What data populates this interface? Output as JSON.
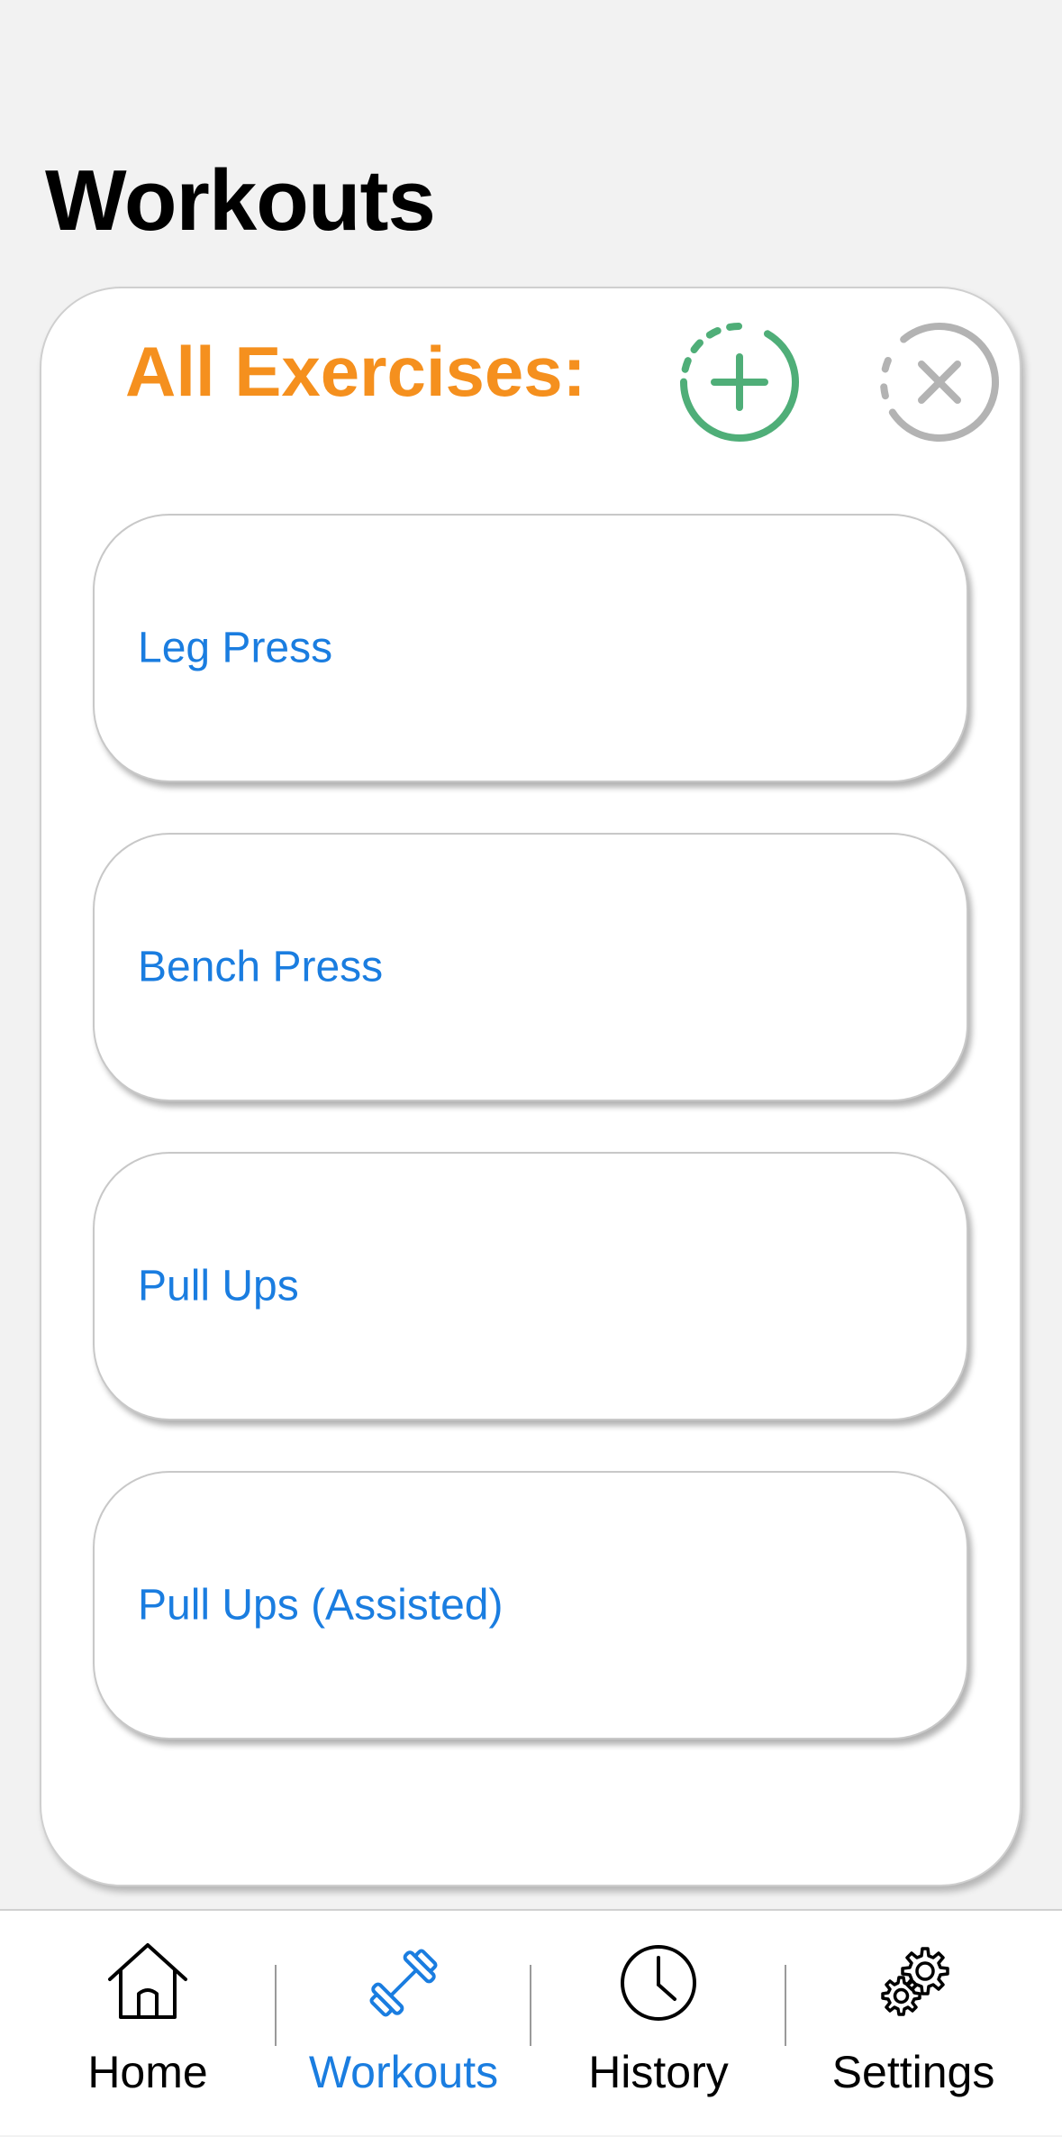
{
  "header": {
    "title": "Workouts"
  },
  "panel": {
    "title": "All Exercises:",
    "add_icon": "add-circle-icon",
    "close_icon": "close-circle-icon"
  },
  "exercises": [
    {
      "label": "Leg Press"
    },
    {
      "label": "Bench Press"
    },
    {
      "label": "Pull Ups"
    },
    {
      "label": "Pull Ups (Assisted)"
    }
  ],
  "tab_bar": {
    "active": "Workouts",
    "tabs": [
      {
        "label": "Home",
        "icon": "house-icon"
      },
      {
        "label": "Workouts",
        "icon": "dumbbell-icon"
      },
      {
        "label": "History",
        "icon": "clock-icon"
      },
      {
        "label": "Settings",
        "icon": "gear-icon"
      }
    ]
  },
  "colors": {
    "accent_orange": "#f5901e",
    "add_green": "#4fae78",
    "close_gray": "#b3b3b3",
    "link_blue": "#1a7de0",
    "background": "#f2f2f2"
  }
}
